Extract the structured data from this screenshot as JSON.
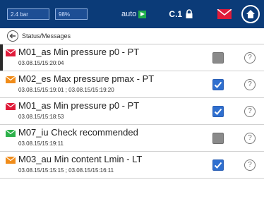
{
  "topbar": {
    "meter1": "2.4 bar",
    "meter2": "98%",
    "mode": "auto",
    "channel": "C.1"
  },
  "header": {
    "title": "Status/Messages"
  },
  "colors": {
    "topbar": "#0b3b78",
    "env_red": "#e01b3a",
    "env_orange": "#f08c1a",
    "env_green": "#2db14a",
    "checkbox_checked": "#2f6fcf",
    "checkbox_unchecked": "#8a8a8a"
  },
  "messages": [
    {
      "title": "M01_as Min pressure p0 - PT",
      "time": "03.08.15/15:20:04",
      "envelope": "red",
      "checked": false,
      "selected": true
    },
    {
      "title": "M02_es Max pressure pmax - PT",
      "time": "03.08.15/15:19:01 ; 03.08.15/15:19:20",
      "envelope": "orange",
      "checked": true,
      "selected": false
    },
    {
      "title": "M01_as Min pressure p0 - PT",
      "time": "03.08.15/15:18:53",
      "envelope": "red",
      "checked": true,
      "selected": false
    },
    {
      "title": "M07_iu Check recommended",
      "time": "03.08.15/15:19:11",
      "envelope": "green",
      "checked": false,
      "selected": false
    },
    {
      "title": "M03_au Min content Lmin - LT",
      "time": "03.08.15/15:15:15 ; 03.08.15/15:16:11",
      "envelope": "orange",
      "checked": true,
      "selected": false
    }
  ],
  "help_glyph": "?"
}
